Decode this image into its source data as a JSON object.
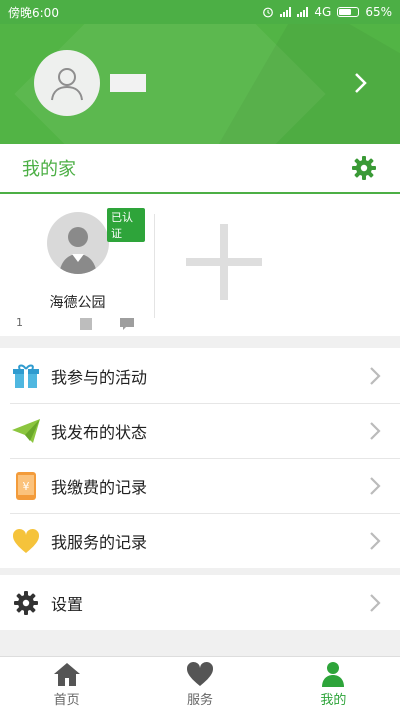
{
  "status_bar": {
    "time": "傍晚6:00",
    "network": "4G",
    "battery": "65%"
  },
  "profile": {
    "chevron_icon": "chevron-right-icon"
  },
  "home": {
    "title": "我的家",
    "settings_icon": "gear-icon",
    "member": {
      "badge": "已认证",
      "name": "海德公园",
      "count": "1"
    },
    "add_icon": "plus-icon"
  },
  "menu": {
    "items": [
      {
        "label": "我参与的活动",
        "icon": "gift-icon"
      },
      {
        "label": "我发布的状态",
        "icon": "paper-plane-icon"
      },
      {
        "label": "我缴费的记录",
        "icon": "payment-phone-icon"
      },
      {
        "label": "我服务的记录",
        "icon": "heart-icon"
      }
    ],
    "settings": {
      "label": "设置",
      "icon": "gear-icon"
    }
  },
  "tabs": [
    {
      "label": "首页",
      "icon": "home-icon",
      "active": false
    },
    {
      "label": "服务",
      "icon": "heart-icon",
      "active": false
    },
    {
      "label": "我的",
      "icon": "user-icon",
      "active": true
    }
  ],
  "colors": {
    "brand_green": "#4caf45",
    "active_tab": "#2ea43a"
  }
}
